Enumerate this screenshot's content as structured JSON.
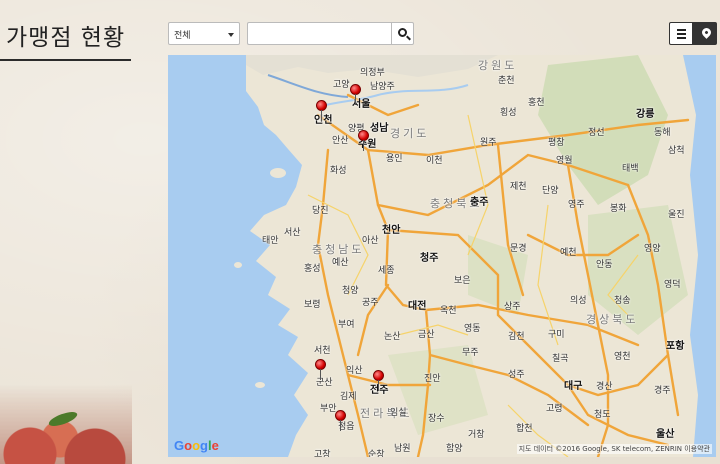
{
  "page": {
    "title": "가맹점 현황"
  },
  "filter": {
    "selected": "전체"
  },
  "search": {
    "placeholder": "",
    "value": ""
  },
  "view_toggle": {
    "list_icon": "list-icon",
    "map_icon": "map-marker-icon",
    "active": "map"
  },
  "map": {
    "region_labels": [
      "강원도",
      "경기도",
      "충청북도",
      "충청남도",
      "경상북도",
      "전라북도"
    ],
    "city_labels": [
      "의정부",
      "고양",
      "남양주",
      "서울",
      "인천",
      "양평",
      "성남",
      "안산",
      "수원",
      "용인",
      "화성",
      "이천",
      "원주",
      "춘천",
      "홍천",
      "평창",
      "횡성",
      "정선",
      "강릉",
      "삼척",
      "동해",
      "태백",
      "영월",
      "제천",
      "충주",
      "단양",
      "영주",
      "봉화",
      "울진",
      "영양",
      "안동",
      "예천",
      "문경",
      "상주",
      "의성",
      "청송",
      "영덕",
      "천안",
      "아산",
      "당진",
      "서산",
      "태안",
      "홍성",
      "예산",
      "세종",
      "청주",
      "보은",
      "옥천",
      "대전",
      "공주",
      "논산",
      "부여",
      "서천",
      "군산",
      "익산",
      "전주",
      "김제",
      "정읍",
      "부안",
      "고창",
      "진안",
      "무주",
      "장수",
      "금산",
      "영동",
      "김천",
      "구미",
      "칠곡",
      "성주",
      "대구",
      "경산",
      "영천",
      "포항",
      "경주",
      "울산",
      "청도",
      "고령",
      "합천",
      "거창",
      "함양",
      "남원",
      "순창",
      "임실",
      "보령",
      "청양"
    ],
    "attribution": "지도 데이터 ©2016 Google, SK telecom, ZENRIN   이용약관",
    "logo_text": "Google",
    "markers": [
      "incheon",
      "seoul",
      "suwon",
      "gunsan",
      "jeonju",
      "jeongeup"
    ]
  }
}
